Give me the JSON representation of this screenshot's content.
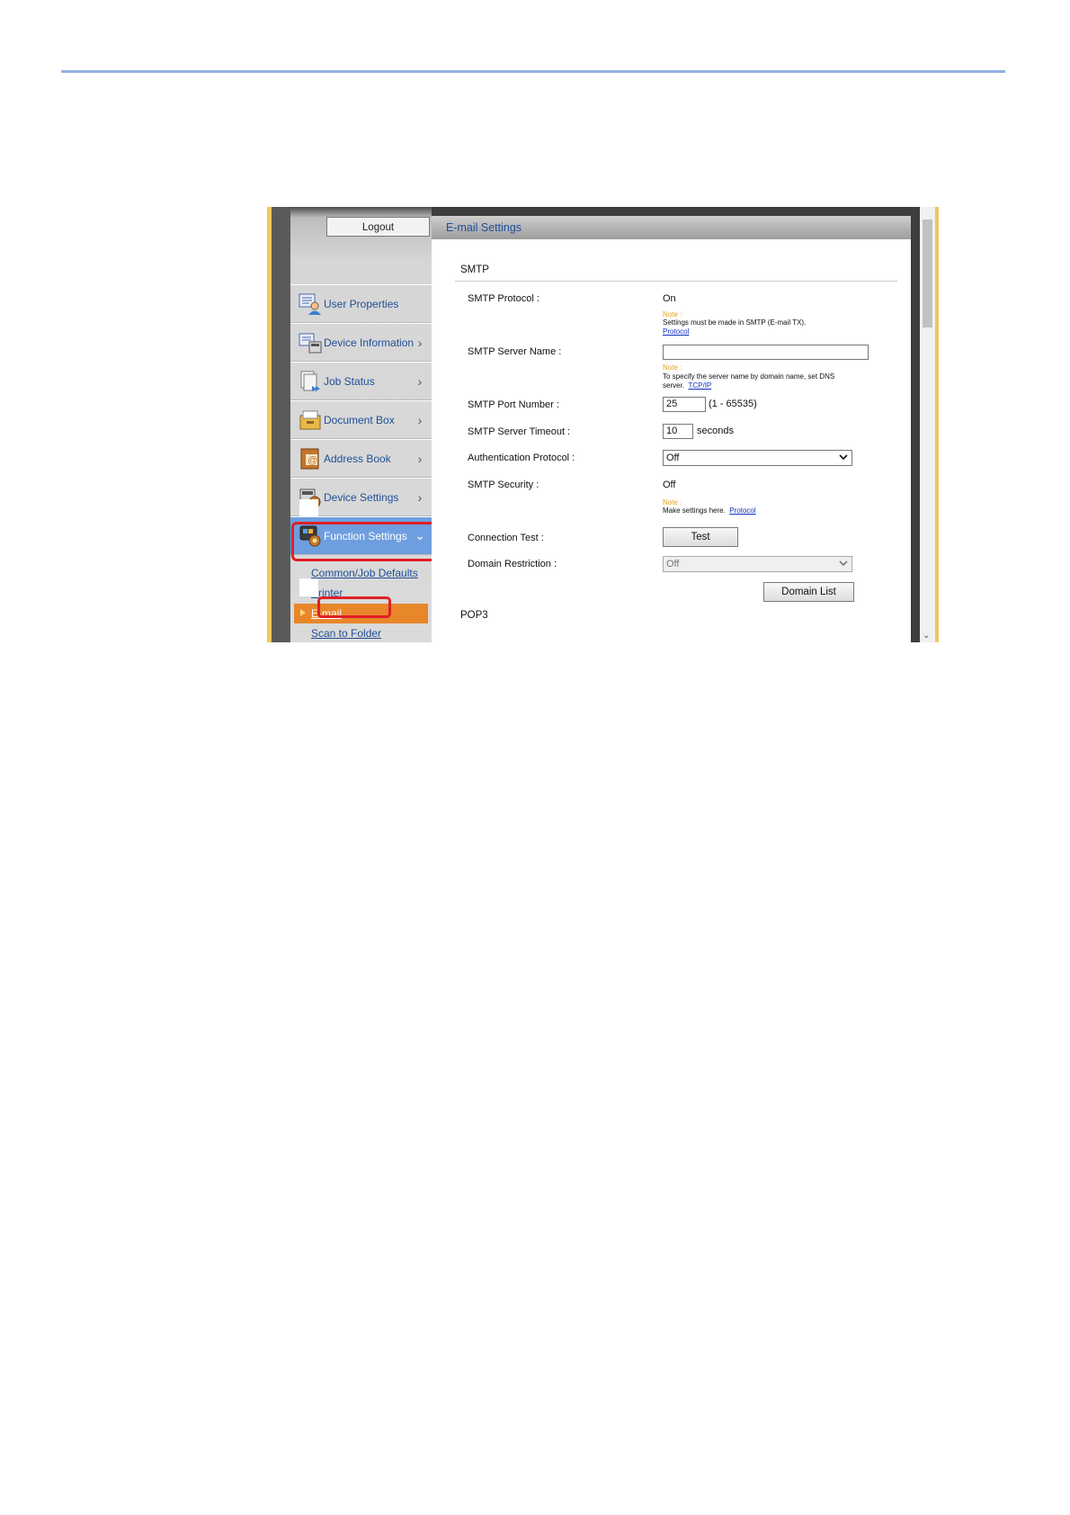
{
  "sidebar": {
    "logout_label": "Logout",
    "nav": [
      {
        "label": "User Properties",
        "icon": "user-properties-icon",
        "chevron": ""
      },
      {
        "label": "Device Information",
        "icon": "device-information-icon",
        "chevron": "›"
      },
      {
        "label": "Job Status",
        "icon": "job-status-icon",
        "chevron": "›"
      },
      {
        "label": "Document Box",
        "icon": "document-box-icon",
        "chevron": "›"
      },
      {
        "label": "Address Book",
        "icon": "address-book-icon",
        "chevron": "›"
      },
      {
        "label": "Device Settings",
        "icon": "device-settings-icon",
        "chevron": "›"
      },
      {
        "label": "Function Settings",
        "icon": "function-settings-icon",
        "chevron": "⌄"
      }
    ],
    "sub": [
      {
        "label": "Common/Job Defaults"
      },
      {
        "label": "Printer"
      },
      {
        "label": "E-mail"
      },
      {
        "label": "Scan to Folder"
      }
    ]
  },
  "main": {
    "header": "E-mail Settings",
    "smtp_section": "SMTP",
    "pop3_section": "POP3",
    "smtp_protocol": {
      "label": "SMTP Protocol :",
      "value": "On"
    },
    "note1": {
      "title": "Note :",
      "text": "Settings must be made in SMTP (E-mail TX).",
      "link": "Protocol"
    },
    "smtp_server_name": {
      "label": "SMTP Server Name :",
      "value": ""
    },
    "note2": {
      "title": "Note :",
      "text_line1": "To specify the server name by domain name, set DNS",
      "text_line2": "server.",
      "link": "TCP/IP"
    },
    "smtp_port": {
      "label": "SMTP Port Number :",
      "value": "25",
      "range": "(1 - 65535)"
    },
    "smtp_timeout": {
      "label": "SMTP Server Timeout :",
      "value": "10",
      "unit": "seconds"
    },
    "auth_protocol": {
      "label": "Authentication Protocol :",
      "value": "Off"
    },
    "smtp_security": {
      "label": "SMTP Security :",
      "value": "Off"
    },
    "note3": {
      "title": "Note :",
      "text": "Make settings here.",
      "link": "Protocol"
    },
    "connection_test": {
      "label": "Connection Test :",
      "button": "Test"
    },
    "domain_restriction": {
      "label": "Domain Restriction :",
      "value": "Off",
      "button": "Domain List"
    }
  }
}
